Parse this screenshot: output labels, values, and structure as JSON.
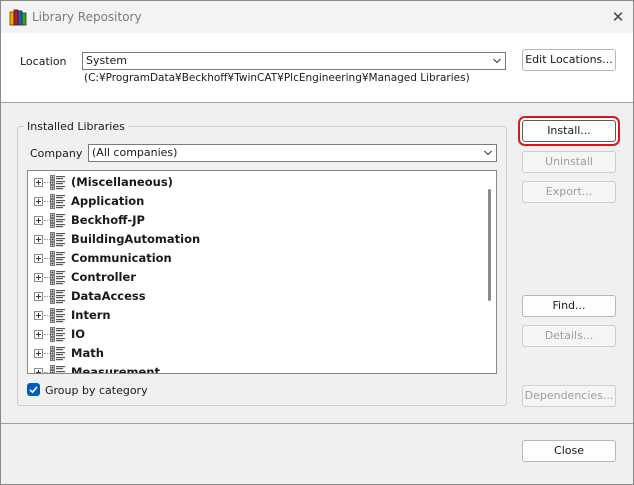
{
  "window": {
    "title": "Library Repository",
    "close_glyph": "✕",
    "app_icon": "library-books-icon"
  },
  "location": {
    "label": "Location",
    "value": "System",
    "path": "(C:¥ProgramData¥Beckhoff¥TwinCAT¥PlcEngineering¥Managed Libraries)",
    "edit_button": "Edit Locations..."
  },
  "installed": {
    "group_title": "Installed Libraries",
    "company_label": "Company",
    "company_value": "(All companies)",
    "categories": [
      "(Miscellaneous)",
      "Application",
      "Beckhoff-JP",
      "BuildingAutomation",
      "Communication",
      "Controller",
      "DataAccess",
      "Intern",
      "IO",
      "Math",
      "Measurement"
    ],
    "group_by_category_label": "Group by category",
    "group_by_category_checked": true
  },
  "actions": {
    "install": "Install...",
    "uninstall": "Uninstall",
    "export": "Export...",
    "find": "Find...",
    "details": "Details...",
    "dependencies": "Dependencies...",
    "close": "Close"
  },
  "colors": {
    "highlight": "#e0141e",
    "checkbox": "#005fb8"
  }
}
